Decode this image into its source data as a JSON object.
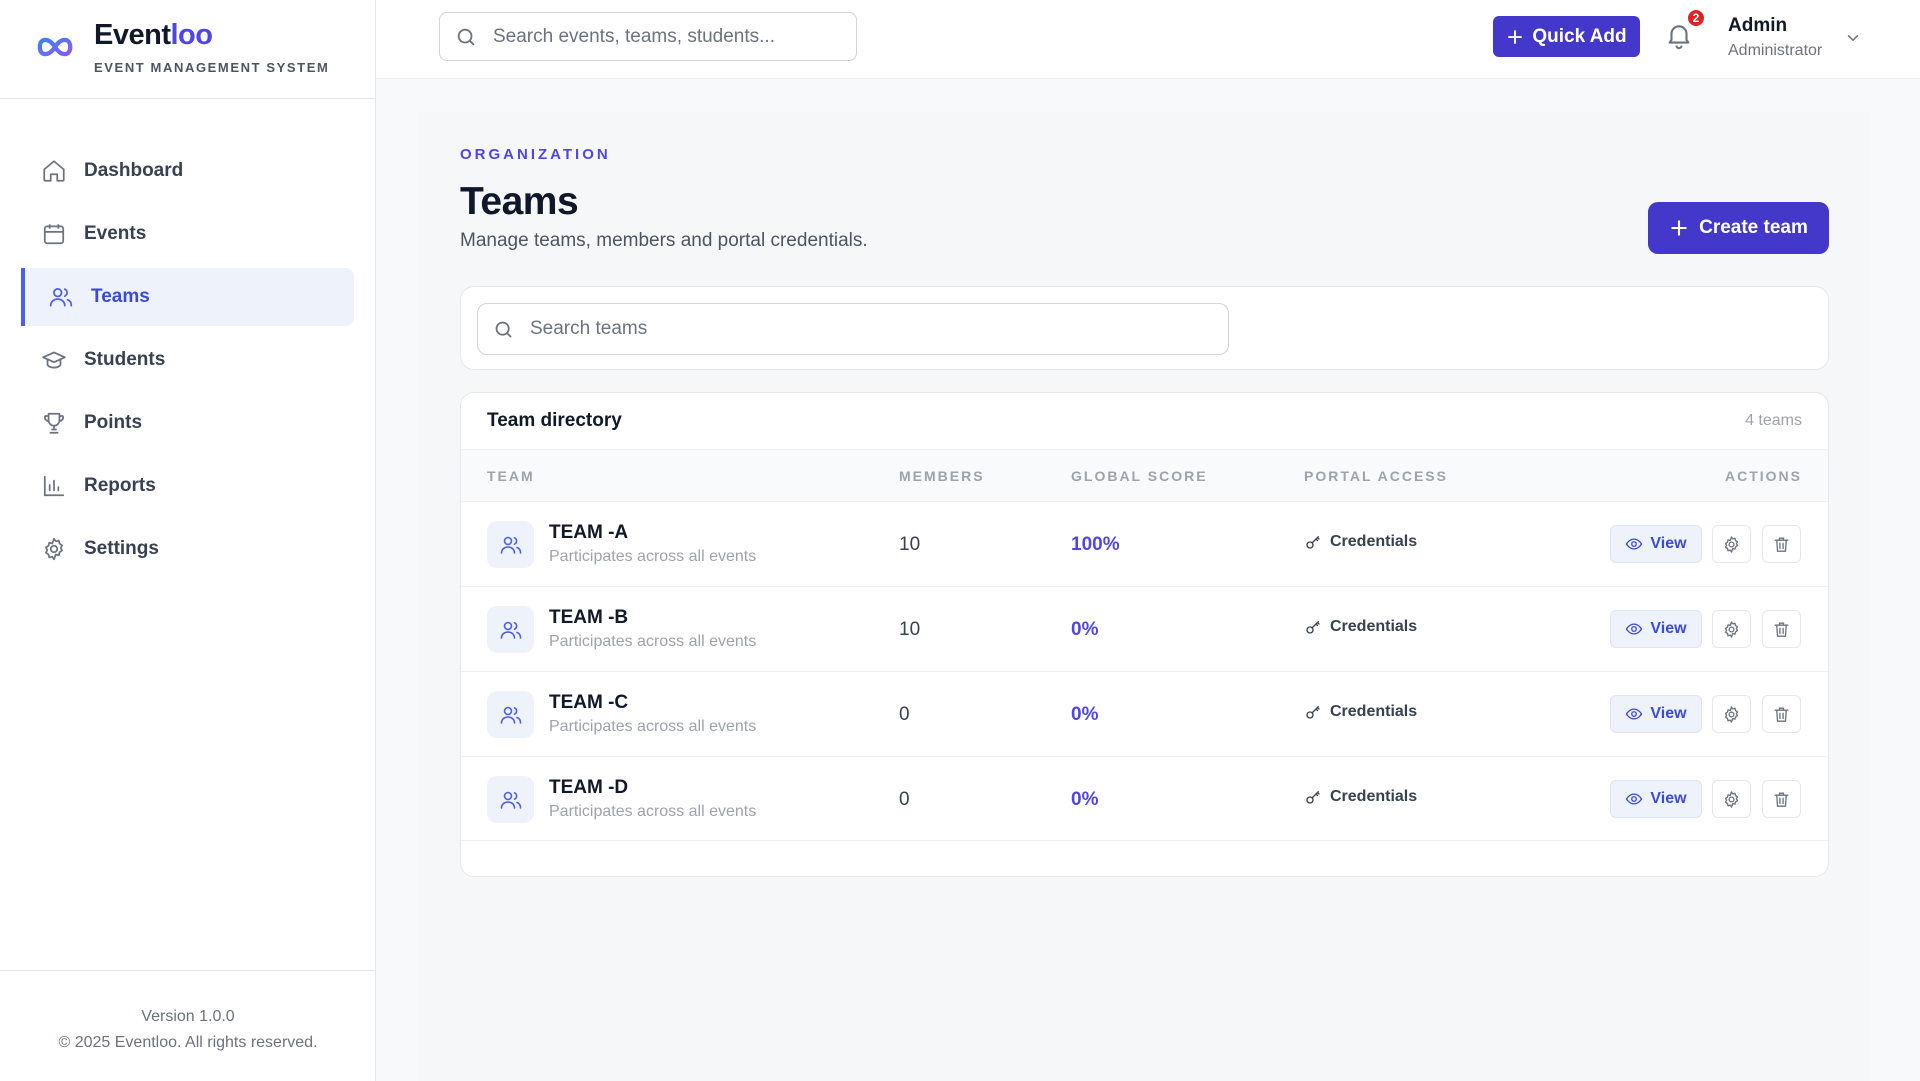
{
  "brand": {
    "name_main": "Event",
    "name_accent": "loo",
    "subtitle": "EVENT MANAGEMENT SYSTEM"
  },
  "sidebar": {
    "items": [
      {
        "label": "Dashboard",
        "icon": "home-icon"
      },
      {
        "label": "Events",
        "icon": "calendar-icon"
      },
      {
        "label": "Teams",
        "icon": "users-icon",
        "active": true
      },
      {
        "label": "Students",
        "icon": "graduation-cap-icon"
      },
      {
        "label": "Points",
        "icon": "trophy-icon"
      },
      {
        "label": "Reports",
        "icon": "bar-chart-icon"
      },
      {
        "label": "Settings",
        "icon": "gear-icon"
      }
    ],
    "footer": {
      "version": "Version 1.0.0",
      "copyright": "© 2025 Eventloo. All rights reserved."
    }
  },
  "header": {
    "search_placeholder": "Search events, teams, students...",
    "quick_add_label": "Quick Add",
    "notification_count": "2",
    "user_name": "Admin",
    "user_role": "Administrator"
  },
  "page": {
    "eyebrow": "ORGANIZATION",
    "title": "Teams",
    "subtitle": "Manage teams, members and portal credentials.",
    "create_button": "Create team",
    "team_search_placeholder": "Search teams"
  },
  "table": {
    "title": "Team directory",
    "count": "4 teams",
    "headers": {
      "team": "TEAM",
      "members": "MEMBERS",
      "score": "GLOBAL SCORE",
      "portal": "PORTAL ACCESS",
      "actions": "ACTIONS"
    },
    "rows": [
      {
        "name": "TEAM -A",
        "desc": "Participates across all events",
        "members": "10",
        "score": "100%",
        "portal": "Credentials",
        "view": "View"
      },
      {
        "name": "TEAM -B",
        "desc": "Participates across all events",
        "members": "10",
        "score": "0%",
        "portal": "Credentials",
        "view": "View"
      },
      {
        "name": "TEAM -C",
        "desc": "Participates across all events",
        "members": "0",
        "score": "0%",
        "portal": "Credentials",
        "view": "View"
      },
      {
        "name": "TEAM -D",
        "desc": "Participates across all events",
        "members": "0",
        "score": "0%",
        "portal": "Credentials",
        "view": "View"
      }
    ]
  },
  "colors": {
    "accent": "#4338ca",
    "active_nav_bg": "#eef2fb",
    "score": "#4f46e5",
    "badge": "#dc2626"
  }
}
